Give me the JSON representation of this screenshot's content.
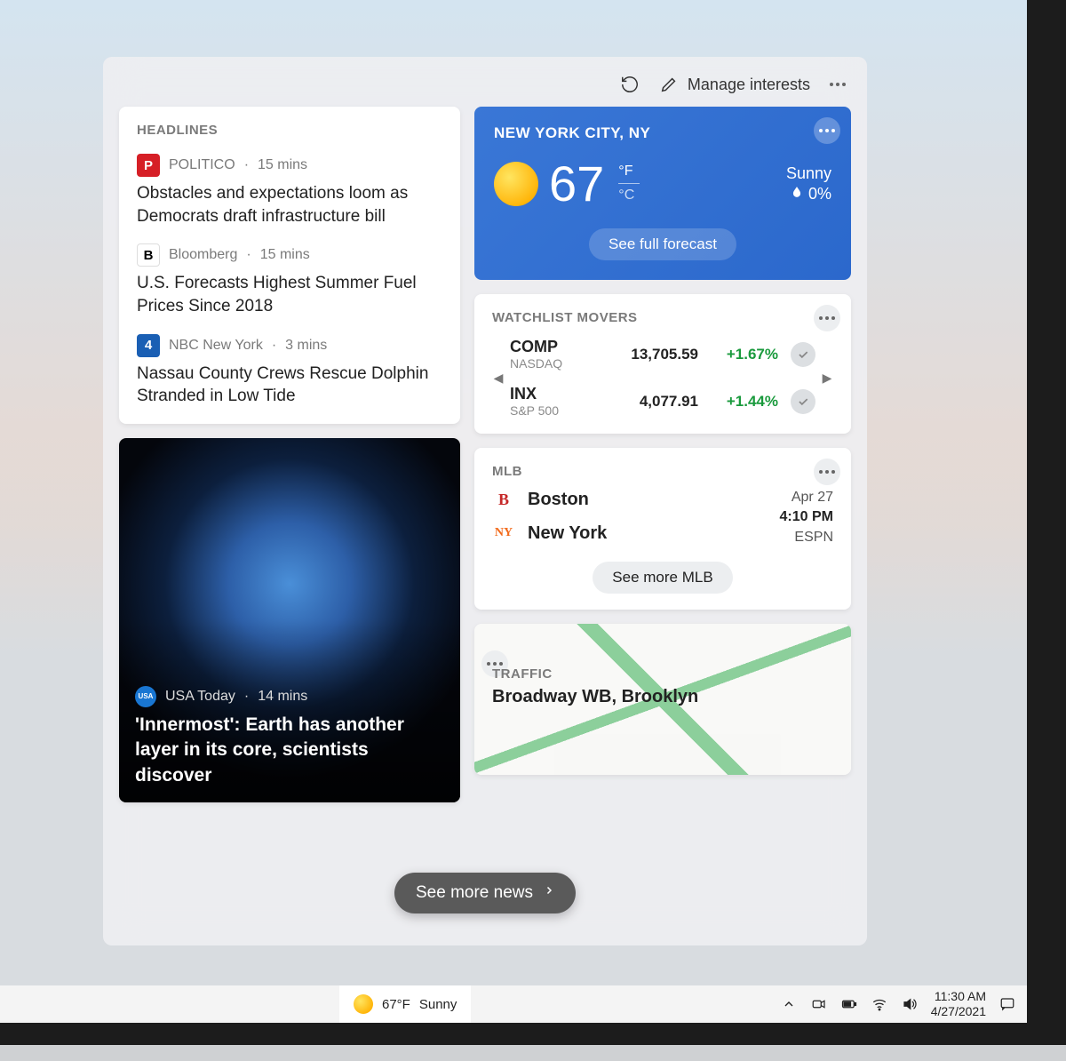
{
  "toolbar": {
    "refresh_label": "Refresh",
    "manage_label": "Manage interests",
    "more_label": "More"
  },
  "headlines": {
    "header": "HEADLINES",
    "items": [
      {
        "source": "POLITICO",
        "age": "15 mins",
        "title": "Obstacles and expectations loom as Democrats draft infrastructure bill",
        "badge": "P",
        "badge_bg": "#d61f26"
      },
      {
        "source": "Bloomberg",
        "age": "15 mins",
        "title": "U.S. Forecasts Highest Summer Fuel Prices Since 2018",
        "badge": "B",
        "badge_color": "#000",
        "badge_bg": "#fff"
      },
      {
        "source": "NBC New York",
        "age": "3 mins",
        "title": "Nassau County Crews Rescue Dolphin Stranded in Low Tide",
        "badge": "4",
        "badge_bg": "#1a5fb4"
      }
    ]
  },
  "feature_news": {
    "source": "USA Today",
    "age": "14 mins",
    "title": "'Innermost': Earth has another layer in its core, scientists discover"
  },
  "weather": {
    "city": "NEW YORK CITY, NY",
    "temp": "67",
    "unit_f": "°F",
    "unit_c": "°C",
    "condition": "Sunny",
    "precip": "0%",
    "forecast_btn": "See full forecast"
  },
  "watchlist": {
    "header": "WATCHLIST MOVERS",
    "stocks": [
      {
        "sym": "COMP",
        "ex": "NASDAQ",
        "price": "13,705.59",
        "change": "+1.67%"
      },
      {
        "sym": "INX",
        "ex": "S&P 500",
        "price": "4,077.91",
        "change": "+1.44%"
      }
    ]
  },
  "mlb": {
    "header": "MLB",
    "teams": [
      {
        "name": "Boston",
        "color": "#c62828",
        "initial": "B"
      },
      {
        "name": "New York",
        "color": "#f26a1b",
        "initial": "NY"
      }
    ],
    "date": "Apr 27",
    "time": "4:10 PM",
    "channel": "ESPN",
    "see_more": "See more MLB"
  },
  "traffic": {
    "header": "TRAFFIC",
    "route": "Broadway WB, Brooklyn"
  },
  "see_more_news": "See more news",
  "taskbar": {
    "weather_temp": "67°F",
    "weather_cond": "Sunny",
    "time": "11:30 AM",
    "date": "4/27/2021"
  }
}
